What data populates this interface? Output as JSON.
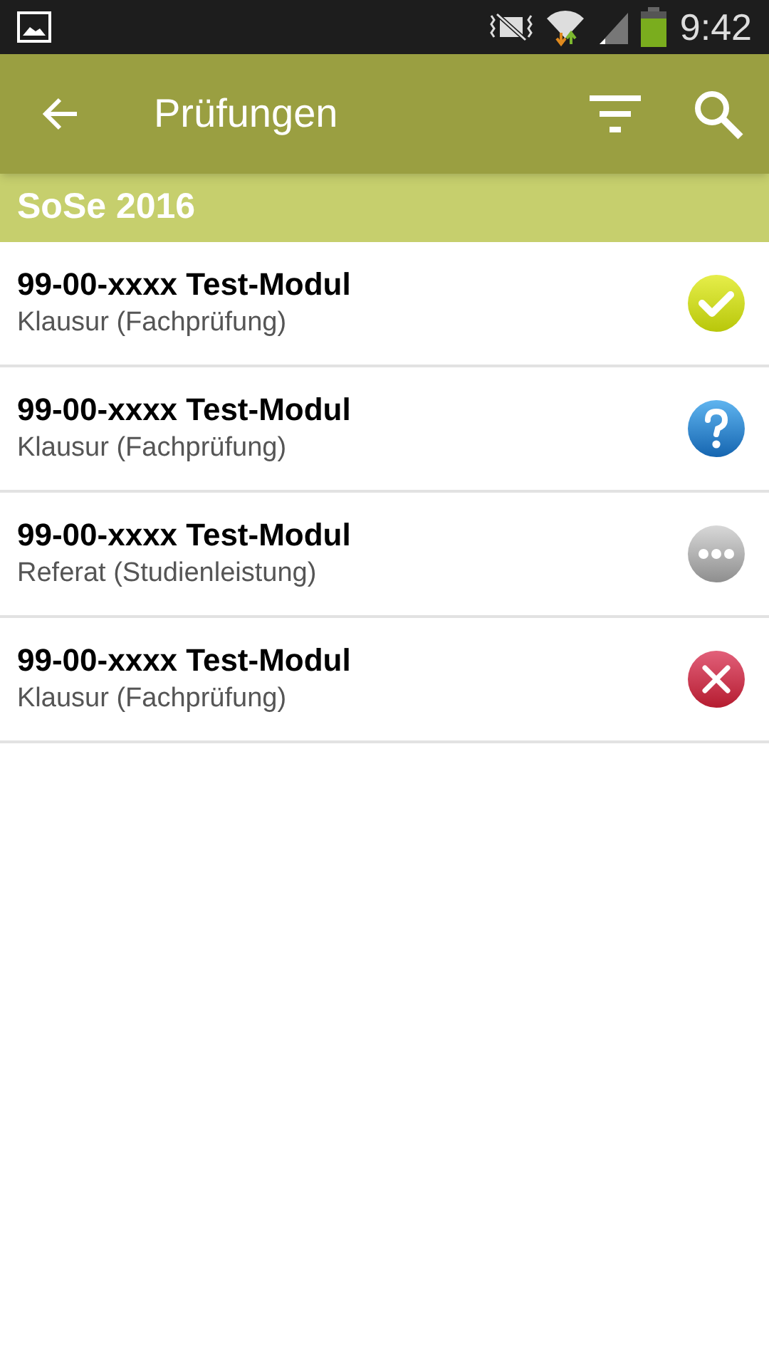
{
  "status_bar": {
    "time": "9:42"
  },
  "app_bar": {
    "title": "Prüfungen"
  },
  "section": {
    "title": "SoSe 2016"
  },
  "exams": [
    {
      "title": "99-00-xxxx Test-Modul",
      "subtitle": "Klausur (Fachprüfung)",
      "kind": "passed"
    },
    {
      "title": "99-00-xxxx Test-Modul",
      "subtitle": "Klausur (Fachprüfung)",
      "kind": "unknown"
    },
    {
      "title": "99-00-xxxx Test-Modul",
      "subtitle": "Referat (Studienleistung)",
      "kind": "pending"
    },
    {
      "title": "99-00-xxxx Test-Modul",
      "subtitle": "Klausur (Fachprüfung)",
      "kind": "failed"
    }
  ]
}
